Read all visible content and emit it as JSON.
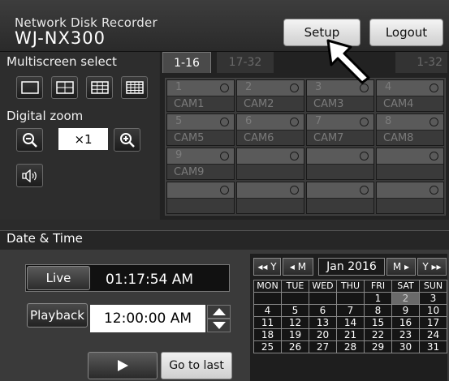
{
  "header": {
    "title_line1": "Network Disk Recorder",
    "title_line2": "WJ-NX300",
    "setup_label": "Setup",
    "logout_label": "Logout"
  },
  "left_panel": {
    "multiscreen_label": "Multiscreen select",
    "digital_zoom_label": "Digital zoom",
    "zoom_value": "×1"
  },
  "tabs": [
    {
      "label": "1-16",
      "active": true
    },
    {
      "label": "17-32",
      "active": false
    },
    {
      "label": "1-32",
      "active": false
    }
  ],
  "cameras": [
    {
      "num": "1",
      "name": "CAM1"
    },
    {
      "num": "2",
      "name": "CAM2"
    },
    {
      "num": "3",
      "name": "CAM3"
    },
    {
      "num": "4",
      "name": "CAM4"
    },
    {
      "num": "5",
      "name": "CAM5"
    },
    {
      "num": "6",
      "name": "CAM6"
    },
    {
      "num": "7",
      "name": "CAM7"
    },
    {
      "num": "8",
      "name": "CAM8"
    },
    {
      "num": "9",
      "name": "CAM9"
    },
    {
      "num": "",
      "name": ""
    },
    {
      "num": "",
      "name": ""
    },
    {
      "num": "",
      "name": ""
    },
    {
      "num": "",
      "name": ""
    },
    {
      "num": "",
      "name": ""
    },
    {
      "num": "",
      "name": ""
    },
    {
      "num": "",
      "name": ""
    }
  ],
  "datetime": {
    "section_label": "Date & Time",
    "live_label": "Live",
    "live_time": "01:17:54 AM",
    "playback_label": "Playback",
    "playback_time": "12:00:00 AM",
    "go_to_last_label": "Go to last"
  },
  "calendar": {
    "prev_year": "◂◂ Y",
    "prev_month": "◂ M",
    "month_year": "Jan 2016",
    "next_month": "M ▸",
    "next_year": "Y ▸▸",
    "weekdays": [
      "MON",
      "TUE",
      "WED",
      "THU",
      "FRI",
      "SAT",
      "SUN"
    ],
    "weeks": [
      [
        "",
        "",
        "",
        "",
        "1",
        "2",
        "3"
      ],
      [
        "4",
        "5",
        "6",
        "7",
        "8",
        "9",
        "10"
      ],
      [
        "11",
        "12",
        "13",
        "14",
        "15",
        "16",
        "17"
      ],
      [
        "18",
        "19",
        "20",
        "21",
        "22",
        "23",
        "24"
      ],
      [
        "25",
        "26",
        "27",
        "28",
        "29",
        "30",
        "31"
      ]
    ],
    "selected_day": "2"
  }
}
